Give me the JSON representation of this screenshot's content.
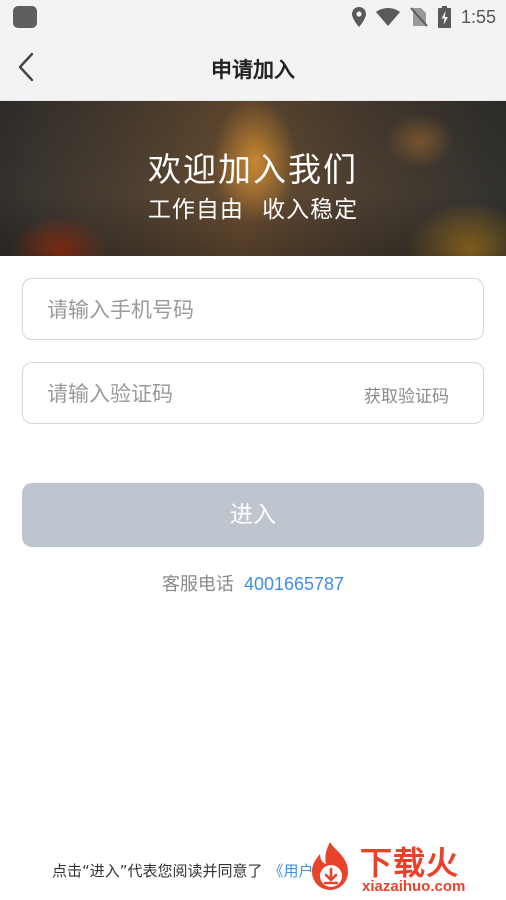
{
  "status_bar": {
    "time": "1:55",
    "icons": [
      "location-icon",
      "wifi-icon",
      "no-sim-icon",
      "battery-charging-icon"
    ]
  },
  "nav": {
    "title": "申请加入",
    "back_icon": "chevron-left-icon"
  },
  "banner": {
    "title": "欢迎加入我们",
    "subtitle": "工作自由 收入稳定"
  },
  "form": {
    "phone_placeholder": "请输入手机号码",
    "phone_value": "",
    "code_placeholder": "请输入验证码",
    "code_value": "",
    "get_code_label": "获取验证码",
    "submit_label": "进入"
  },
  "service": {
    "label": "客服电话",
    "phone": "4001665787"
  },
  "agreement": {
    "text": "点击“进入”代表您阅读并同意了",
    "link": "《用户"
  },
  "watermark": {
    "text": "下载火",
    "url": "xiazaihuo.com"
  },
  "colors": {
    "accent": "#3f8ee6",
    "button_disabled": "#bfc5cf",
    "watermark": "#e8432a"
  }
}
